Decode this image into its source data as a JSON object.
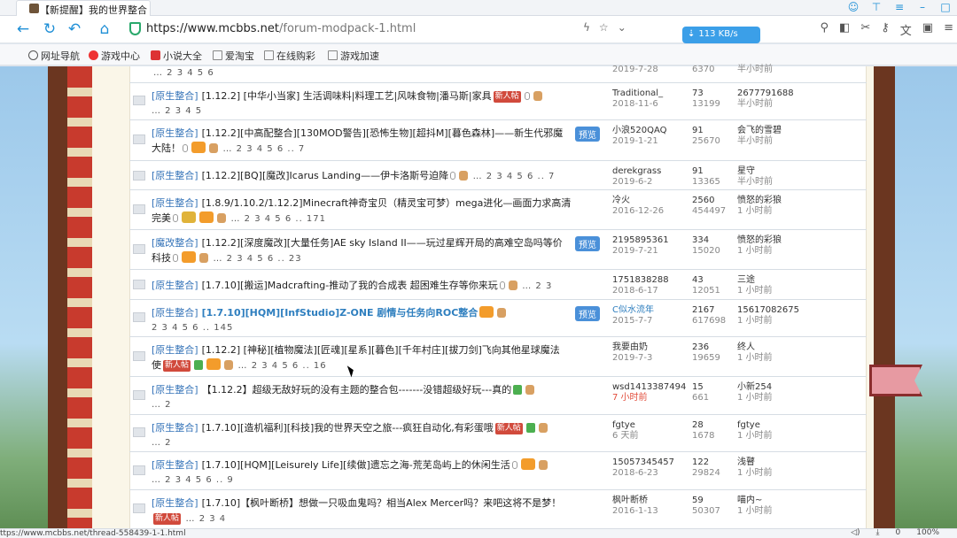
{
  "browser": {
    "tab_title": "【新提醒】我的世界整合",
    "url_host": "https://www.mcbbs.net",
    "url_path": "/forum-modpack-1.html",
    "speed": "113 KB/s",
    "bookmarks": [
      "网址导航",
      "游戏中心",
      "小说大全",
      "爱淘宝",
      "在线购彩",
      "游戏加速"
    ]
  },
  "status_url": "ttps://www.mcbbs.net/thread-558439-1-1.html",
  "status_icons": [
    "0",
    "100%"
  ],
  "threads": [
    {
      "cat": "",
      "title": "",
      "pager": "… 2 3 4 5 6",
      "author": "",
      "date": "2019-7-28",
      "replies": "",
      "views": "6370",
      "last_user": "",
      "last_time": "半小时前"
    },
    {
      "cat": "[原生整合]",
      "title": "[1.12.2] [中华小当家] 生活调味料|料理工艺|风味食物|潘马斯|家具",
      "badge": "新人帖",
      "pager": "… 2 3 4 5",
      "author": "Traditional_",
      "date": "2018-11-6",
      "replies": "73",
      "views": "13199",
      "last_user": "2677791688",
      "last_time": "半小时前"
    },
    {
      "cat": "[原生整合]",
      "title": "[1.12.2][中高配整合][130MOD警告][恐怖生物][超抖M][暮色森林]——新生代邪魔大陆！",
      "preview": "预览",
      "pager": "… 2 3 4 5 6 .. 7",
      "author": "小浪520QAQ",
      "date": "2019-1-21",
      "replies": "91",
      "views": "25670",
      "last_user": "会飞的雪碧",
      "last_time": "半小时前"
    },
    {
      "cat": "[原生整合]",
      "title": "[1.12.2][BQ][魔改]Icarus Landing——伊卡洛斯号迫降",
      "pager": "… 2 3 4 5 6 .. 7",
      "author": "derekgrass",
      "date": "2019-6-2",
      "replies": "91",
      "views": "13365",
      "last_user": "星守",
      "last_time": "半小时前"
    },
    {
      "cat": "[原生整合]",
      "title": "[1.8.9/1.10.2/1.12.2]Minecraft神奇宝贝（精灵宝可梦）mega进化—画面力求高清完美",
      "pager": "… 2 3 4 5 6 .. 171",
      "author": "冷火",
      "date": "2016-12-26",
      "replies": "2560",
      "views": "454497",
      "last_user": "愤怒的彩狼",
      "last_time": "1 小时前"
    },
    {
      "cat": "[魔改整合]",
      "title": "[1.12.2][深度魔改][大量任务]AE sky Island II——玩过星辉开局的高难空岛吗等价科技",
      "preview": "预览",
      "pager": "… 2 3 4 5 6 .. 23",
      "author": "2195895361",
      "date": "2019-7-21",
      "replies": "334",
      "views": "15020",
      "last_user": "愤怒的彩狼",
      "last_time": "1 小时前"
    },
    {
      "cat": "[原生整合]",
      "title": "[1.7.10][搬运]Madcrafting-推动了我的合成表 超困难生存等你来玩",
      "pager": "… 2 3",
      "author": "1751838288",
      "date": "2018-6-17",
      "replies": "43",
      "views": "12051",
      "last_user": "三途",
      "last_time": "1 小时前"
    },
    {
      "cat": "[原生整合]",
      "title": "[1.7.10][HQM][InfStudio]Z-ONE 剧情与任务向ROC整合",
      "bold": true,
      "preview": "预览",
      "pager": "2 3 4 5 6 .. 145",
      "author": "C似水流年",
      "date": "2015-7-7",
      "replies": "2167",
      "views": "617698",
      "last_user": "15617082675",
      "last_time": "1 小时前"
    },
    {
      "cat": "[原生整合]",
      "title": "[1.12.2] [神秘][植物魔法][匠魂][星系][暮色][千年村庄][拔刀剑]飞向其他星球魔法使",
      "badge": "新人帖",
      "pager": "… 2 3 4 5 6 .. 16",
      "author": "我要由奶",
      "date": "2019-7-3",
      "replies": "236",
      "views": "19659",
      "last_user": "终人",
      "last_time": "1 小时前"
    },
    {
      "cat": "[原生整合]",
      "title": "【1.12.2】超级无敌好玩的没有主题的整合包-------没错超级好玩---真的",
      "pager": "… 2",
      "author": "wsd1413387494",
      "date": "7 小时前",
      "date_red": true,
      "replies": "15",
      "views": "661",
      "last_user": "小新254",
      "last_time": "1 小时前"
    },
    {
      "cat": "[原生整合]",
      "title": "[1.7.10][造机福利][科技]我的世界天空之旅---疯狂自动化,有彩蛋哦",
      "badge": "新人帖",
      "pager": "… 2",
      "author": "fgtye",
      "date": "6 天前",
      "replies": "28",
      "views": "1678",
      "last_user": "fgtye",
      "last_time": "1 小时前"
    },
    {
      "cat": "[原生整合]",
      "title": "[1.7.10][HQM][Leisurely Life][续做]遗忘之海-荒芜岛屿上的休闲生活",
      "pager": "… 2 3 4 5 6 .. 9",
      "author": "15057345457",
      "date": "2018-6-23",
      "replies": "122",
      "views": "29824",
      "last_user": "浅瞽",
      "last_time": "1 小时前"
    },
    {
      "cat": "[原生整合]",
      "title": "[1.7.10]【枫叶断桥】想做一只吸血鬼吗？相当Alex Mercer吗？来吧这将不是梦！",
      "badge": "新人帖",
      "pager": "… 2 3 4",
      "author": "枫叶断桥",
      "date": "2016-1-13",
      "replies": "59",
      "views": "50307",
      "last_user": "喵内~",
      "last_time": "1 小时前"
    }
  ]
}
